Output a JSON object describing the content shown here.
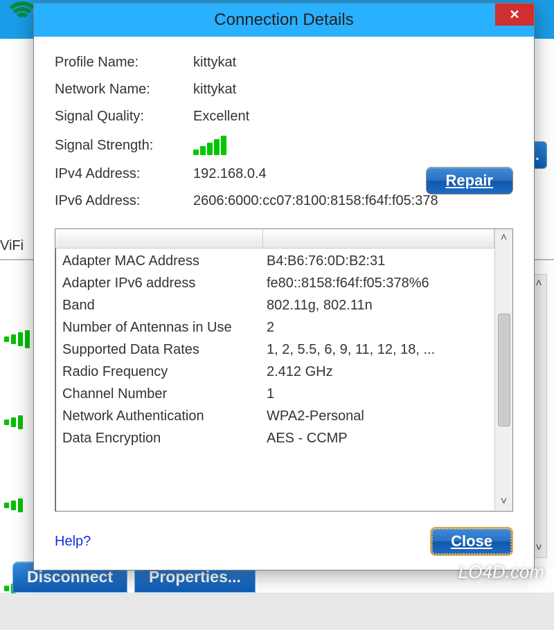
{
  "bg": {
    "vifi_label": "ViFi",
    "s_btn": "s...",
    "disconnect": "Disconnect",
    "properties": "Properties...",
    "watermark_l": "LO4D",
    "watermark_r": ".com"
  },
  "modal": {
    "title": "Connection Details",
    "repair": "Repair",
    "close": "Close",
    "help": "Help?",
    "fields": {
      "profile_name_label": "Profile Name:",
      "profile_name_value": "kittykat",
      "network_name_label": "Network Name:",
      "network_name_value": "kittykat",
      "signal_quality_label": "Signal Quality:",
      "signal_quality_value": "Excellent",
      "signal_strength_label": "Signal Strength:",
      "ipv4_label": "IPv4 Address:",
      "ipv4_value": "192.168.0.4",
      "ipv6_label": "IPv6 Address:",
      "ipv6_value": "2606:6000:cc07:8100:8158:f64f:f05:378"
    },
    "details": [
      {
        "k": "Adapter MAC Address",
        "v": "B4:B6:76:0D:B2:31"
      },
      {
        "k": "Adapter IPv6 address",
        "v": "fe80::8158:f64f:f05:378%6"
      },
      {
        "k": "Band",
        "v": "802.11g, 802.11n"
      },
      {
        "k": "Number of Antennas in Use",
        "v": "2"
      },
      {
        "k": "Supported Data Rates",
        "v": "1, 2, 5.5, 6, 9, 11, 12, 18, ..."
      },
      {
        "k": "Radio Frequency",
        "v": "2.412 GHz"
      },
      {
        "k": "Channel Number",
        "v": "1"
      },
      {
        "k": "Network Authentication",
        "v": "WPA2-Personal"
      },
      {
        "k": "Data Encryption",
        "v": "AES - CCMP"
      }
    ]
  }
}
